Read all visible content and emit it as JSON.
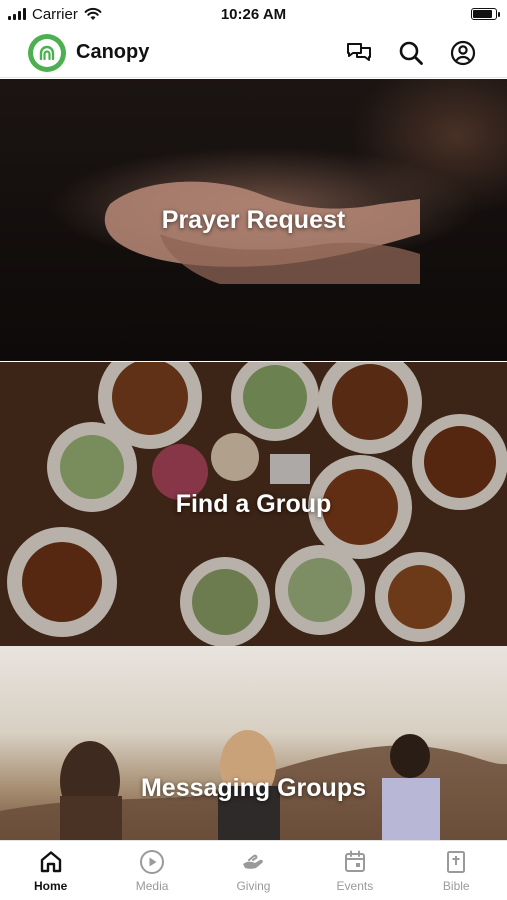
{
  "status_bar": {
    "carrier": "Carrier",
    "time": "10:26 AM"
  },
  "header": {
    "app_name": "Canopy",
    "brand_color": "#4caf50",
    "icons": [
      "chat-icon",
      "search-icon",
      "account-icon"
    ]
  },
  "cards": [
    {
      "title": "Prayer Request",
      "image": "praying-hands"
    },
    {
      "title": "Find a Group",
      "image": "dinner-table"
    },
    {
      "title": "Messaging Groups",
      "image": "friends-sunset"
    }
  ],
  "tabs": [
    {
      "label": "Home",
      "icon": "home-icon",
      "active": true
    },
    {
      "label": "Media",
      "icon": "play-icon",
      "active": false
    },
    {
      "label": "Giving",
      "icon": "giving-hand-icon",
      "active": false
    },
    {
      "label": "Events",
      "icon": "calendar-icon",
      "active": false
    },
    {
      "label": "Bible",
      "icon": "bible-icon",
      "active": false
    }
  ]
}
